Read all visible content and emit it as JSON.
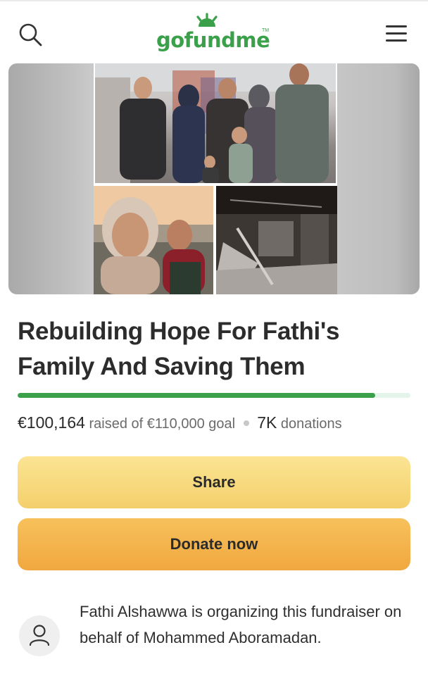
{
  "header": {
    "logo_text": "gofundme",
    "logo_tm": "TM",
    "search_icon": "search-icon",
    "menu_icon": "hamburger-menu-icon"
  },
  "hero": {
    "photos": [
      "family-group-photo",
      "selfie-photo",
      "burned-room-photo"
    ]
  },
  "fundraiser": {
    "title": "Rebuilding Hope For Fathi's Family And Saving Them",
    "raised": "€100,164",
    "raised_label": "raised of €110,000 goal",
    "donations_count": "7K",
    "donations_label": "donations",
    "progress_fraction": 0.91
  },
  "actions": {
    "share_label": "Share",
    "donate_label": "Donate now"
  },
  "organizer": {
    "text": "Fathi Alshawwa is organizing this fundraiser on behalf of Mohammed Aboramadan.",
    "avatar_icon": "person-icon"
  },
  "colors": {
    "brand_green": "#3aa14a",
    "share_yellow": "#f4d06c",
    "donate_orange": "#f1a73f",
    "progress_track": "#e4f4ea"
  }
}
